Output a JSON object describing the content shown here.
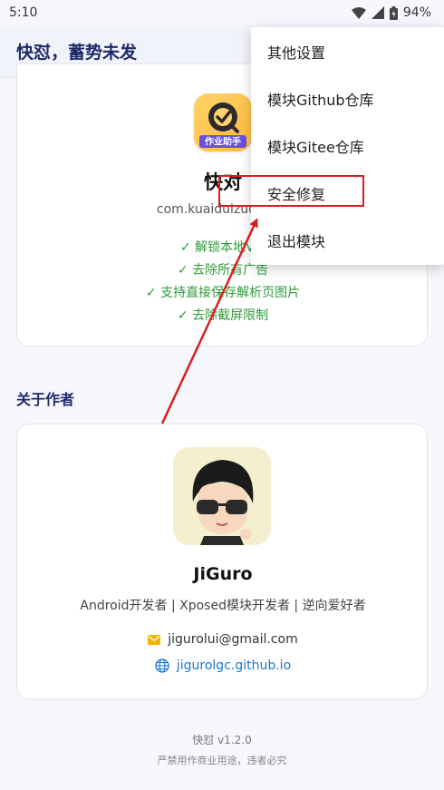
{
  "status_bar": {
    "time": "5:10",
    "battery": "94%"
  },
  "app_bar": {
    "title": "快怼，蓄势未发"
  },
  "target_app": {
    "name": "快对",
    "package": "com.kuaiduizuoye.sc",
    "icon_label": "作业助手",
    "features": [
      "✓ 解锁本地VIP",
      "✓ 去除所有广告",
      "✓ 支持直接保存解析页图片",
      "✓ 去除截屏限制"
    ]
  },
  "about": {
    "section_title": "关于作者",
    "name": "JiGuro",
    "description": "Android开发者 | Xposed模块开发者 | 逆向爱好者",
    "email": "jigurolui@gmail.com",
    "website": "jigurolgc.github.io"
  },
  "footer": {
    "version": "快怼 v1.2.0",
    "note": "严禁用作商业用途，违者必究"
  },
  "menu": {
    "items": [
      "其他设置",
      "模块Github仓库",
      "模块Gitee仓库",
      "安全修复",
      "退出模块"
    ]
  },
  "colors": {
    "accent": "#1f2a6b",
    "feature": "#2e9b3a",
    "link": "#1976d2",
    "highlight": "#d91e1e"
  }
}
